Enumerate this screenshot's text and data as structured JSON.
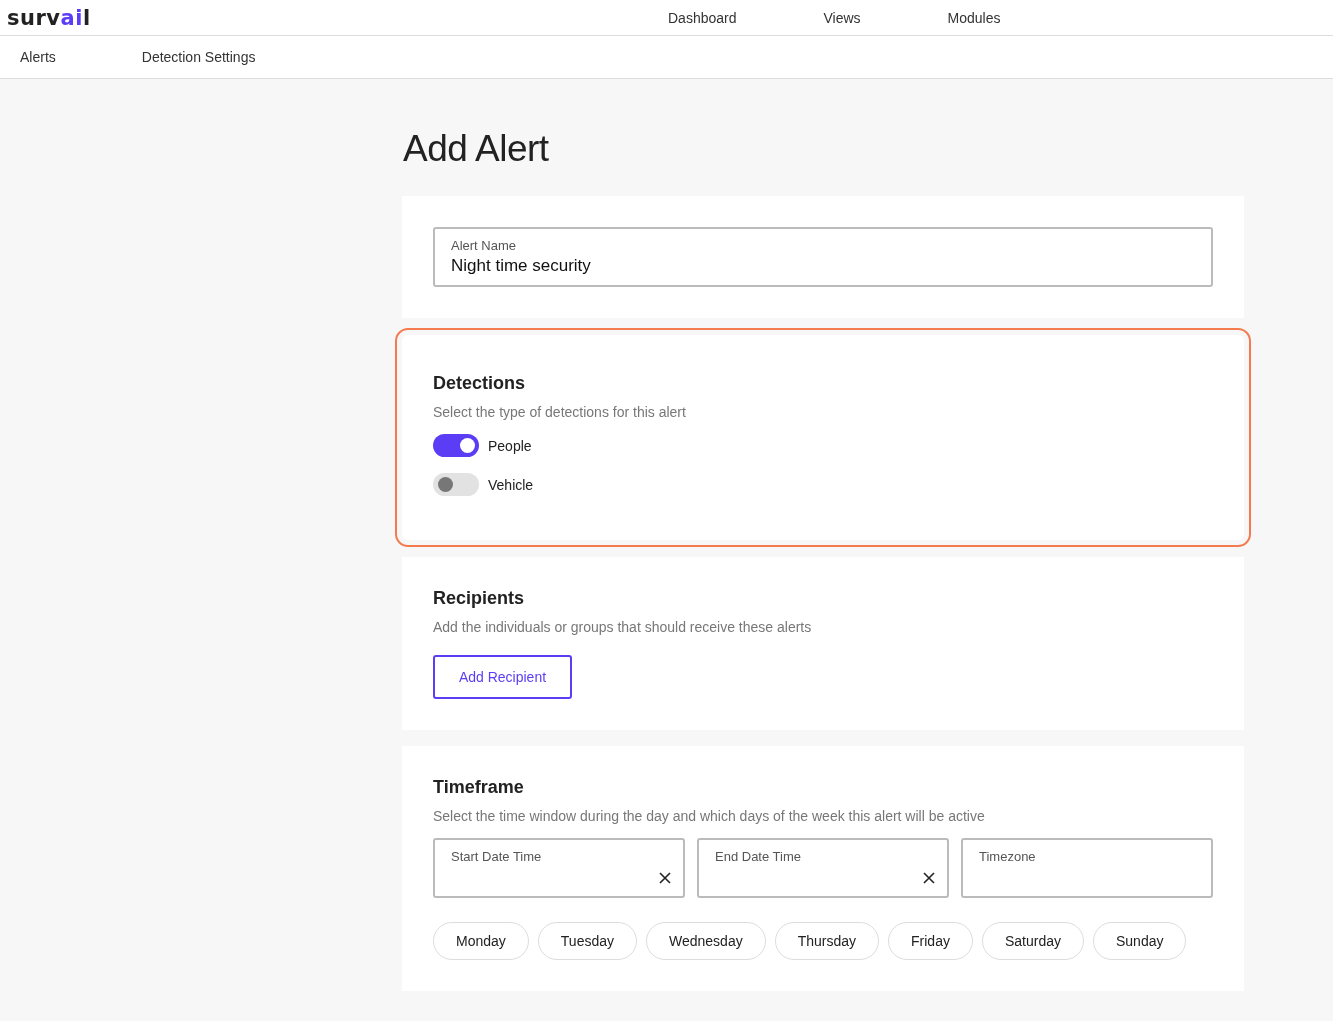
{
  "logo": {
    "parts": [
      {
        "text": "surv",
        "accent": false
      },
      {
        "text": "ai",
        "accent": true
      },
      {
        "text": "l",
        "accent": false
      }
    ]
  },
  "top_nav": [
    "Dashboard",
    "Views",
    "Modules"
  ],
  "sub_nav": [
    "Alerts",
    "Detection Settings"
  ],
  "page_title": "Add Alert",
  "alert_name": {
    "label": "Alert Name",
    "value": "Night time security"
  },
  "detections": {
    "highlighted": true,
    "title": "Detections",
    "description": "Select the type of detections for this alert",
    "toggles": [
      {
        "label": "People",
        "on": true
      },
      {
        "label": "Vehicle",
        "on": false
      }
    ]
  },
  "recipients": {
    "highlighted": false,
    "title": "Recipients",
    "description": "Add the individuals or groups that should receive these alerts",
    "button": "Add Recipient"
  },
  "timeframe": {
    "highlighted": false,
    "title": "Timeframe",
    "description": "Select the time window during the day and which days of the week this alert will be active",
    "fields": [
      {
        "label": "Start Date Time",
        "clearable": true
      },
      {
        "label": "End Date Time",
        "clearable": true
      },
      {
        "label": "Timezone",
        "clearable": false
      }
    ],
    "days": [
      "Monday",
      "Tuesday",
      "Wednesday",
      "Thursday",
      "Friday",
      "Saturday",
      "Sunday"
    ]
  }
}
